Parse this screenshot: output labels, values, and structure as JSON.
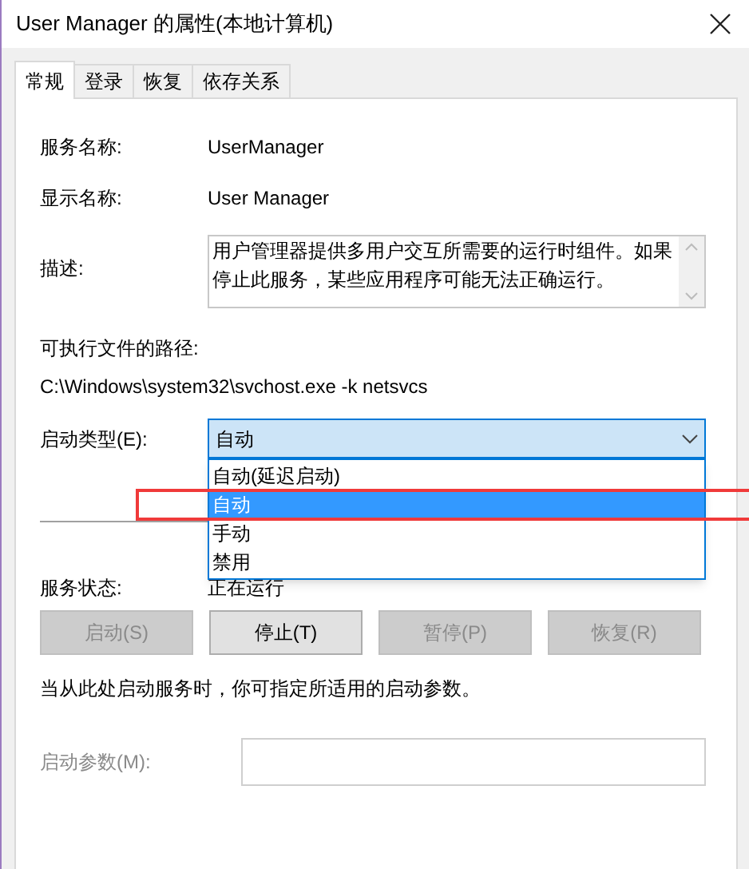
{
  "window": {
    "title": "User Manager 的属性(本地计算机)"
  },
  "tabs": [
    {
      "label": "常规",
      "selected": true
    },
    {
      "label": "登录",
      "selected": false
    },
    {
      "label": "恢复",
      "selected": false
    },
    {
      "label": "依存关系",
      "selected": false
    }
  ],
  "service_name": {
    "label": "服务名称:",
    "value": "UserManager"
  },
  "display_name": {
    "label": "显示名称:",
    "value": "User Manager"
  },
  "description": {
    "label": "描述:",
    "value": "用户管理器提供多用户交互所需要的运行时组件。如果停止此服务，某些应用程序可能无法正确运行。"
  },
  "path": {
    "label": "可执行文件的路径:",
    "value": "C:\\Windows\\system32\\svchost.exe -k netsvcs"
  },
  "startup_type": {
    "label": "启动类型(E):",
    "value": "自动",
    "expanded": true,
    "options": [
      {
        "label": "自动(延迟启动)",
        "selected": false
      },
      {
        "label": "自动",
        "selected": true
      },
      {
        "label": "手动",
        "selected": false
      },
      {
        "label": "禁用",
        "selected": false
      }
    ]
  },
  "annotation_frame": true,
  "service_status": {
    "label": "服务状态:",
    "value": "正在运行"
  },
  "buttons": [
    {
      "label": "启动(S)",
      "disabled": true
    },
    {
      "label": "停止(T)",
      "disabled": false
    },
    {
      "label": "暂停(P)",
      "disabled": true
    },
    {
      "label": "恢复(R)",
      "disabled": true
    }
  ],
  "hint": "当从此处启动服务时，你可指定所适用的启动参数。",
  "start_parameters": {
    "label": "启动参数(M):",
    "disabled": true
  }
}
